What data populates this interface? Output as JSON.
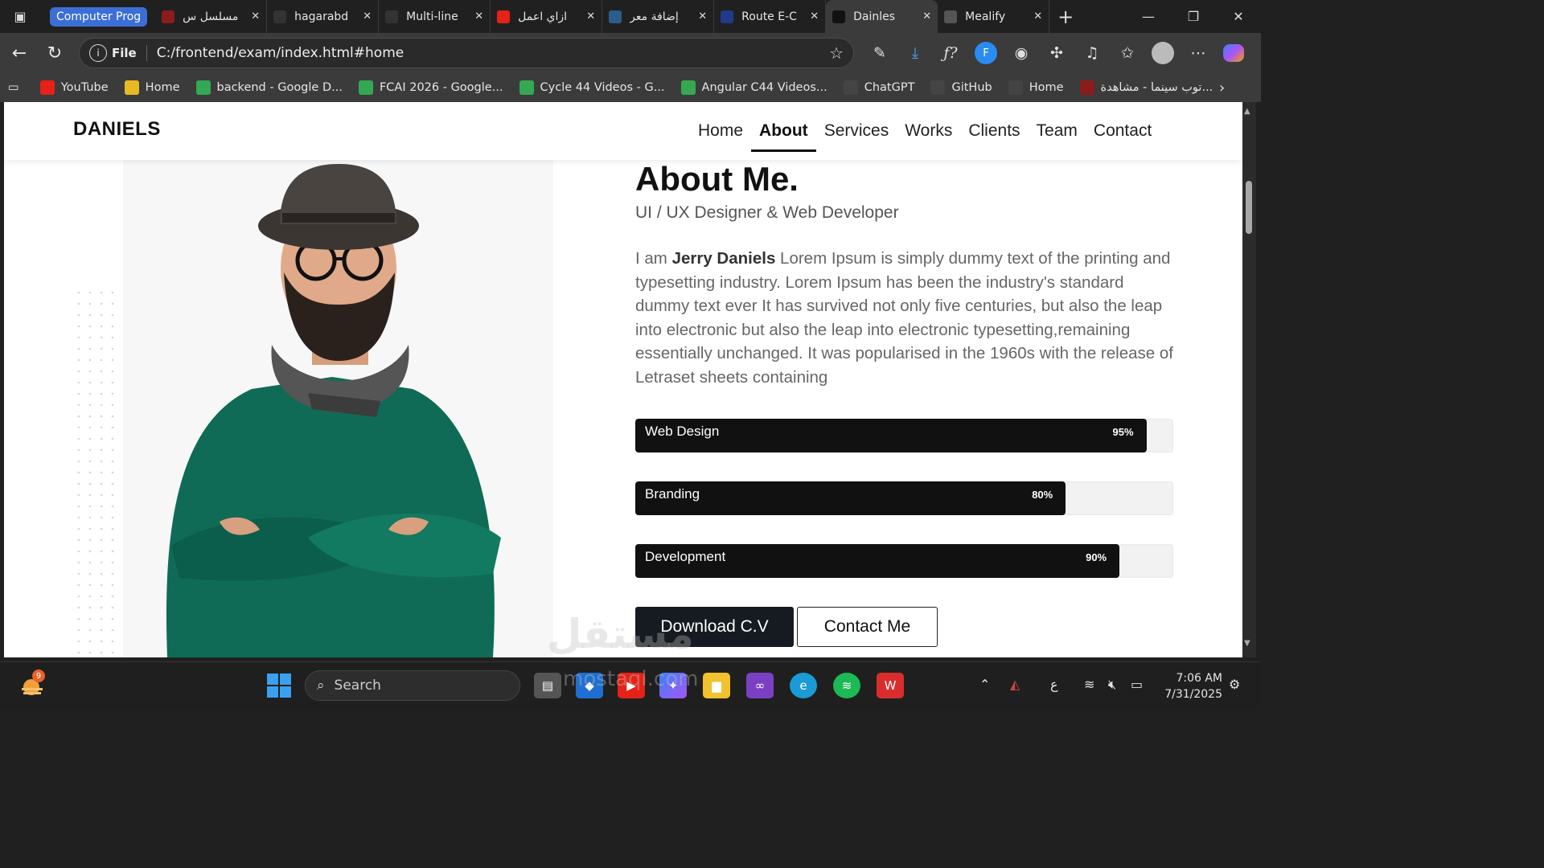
{
  "browser": {
    "tab_group": "Computer Prog",
    "tabs": [
      {
        "label": "مسلسل س",
        "icon": "top-cinema-icon",
        "color": "#8b1c1c"
      },
      {
        "label": "hagarabd",
        "icon": "github-icon",
        "color": "#333333"
      },
      {
        "label": "Multi-line",
        "icon": "chatgpt-icon",
        "color": "#333333"
      },
      {
        "label": "ازاي اعمل",
        "icon": "youtube-icon",
        "color": "#e62117"
      },
      {
        "label": "إضافة معر",
        "icon": "circle-icon",
        "color": "#2b5d8c"
      },
      {
        "label": "Route E-C",
        "icon": "route-icon",
        "color": "#1f3a8a"
      },
      {
        "label": "Dainles",
        "icon": "h-icon",
        "color": "#111111",
        "active": true
      },
      {
        "label": "Mealify",
        "icon": "globe-icon",
        "color": "#555555"
      }
    ],
    "address": {
      "scheme_label": "File",
      "url": "C:/frontend/exam/index.html#home"
    },
    "bookmarks": [
      {
        "label": "YouTube",
        "color": "#e62117"
      },
      {
        "label": "Home",
        "color": "#e8b923"
      },
      {
        "label": "backend - Google D...",
        "color": "#34a853"
      },
      {
        "label": "FCAI 2026 - Google...",
        "color": "#34a853"
      },
      {
        "label": "Cycle 44 Videos - G...",
        "color": "#34a853"
      },
      {
        "label": "Angular C44 Videos...",
        "color": "#34a853"
      },
      {
        "label": "ChatGPT",
        "color": "#444444"
      },
      {
        "label": "GitHub",
        "color": "#444444"
      },
      {
        "label": "Home",
        "color": "#444444"
      },
      {
        "label": "توب سينما - مشاهدة...",
        "color": "#8b1c1c"
      }
    ]
  },
  "site": {
    "brand": "DANIELS",
    "nav": [
      "Home",
      "About",
      "Services",
      "Works",
      "Clients",
      "Team",
      "Contact"
    ],
    "active_nav": "About",
    "about": {
      "title": "About Me.",
      "subtitle": "UI / UX Designer & Web Developer",
      "intro": "I am ",
      "name": "Jerry Daniels",
      "body": " Lorem Ipsum is simply dummy text of the printing and typesetting industry. Lorem Ipsum has been the industry's standard dummy text ever It has survived not only five centuries, but also the leap into electronic but also the leap into electronic typesetting,remaining essentially unchanged. It was popularised in the 1960s with the release of Letraset sheets containing"
    },
    "skills": [
      {
        "name": "Web Design",
        "percent": 95,
        "label": "95%"
      },
      {
        "name": "Branding",
        "percent": 80,
        "label": "80%"
      },
      {
        "name": "Development",
        "percent": 90,
        "label": "90%"
      }
    ],
    "buttons": {
      "download": "Download C.V",
      "contact": "Contact Me"
    }
  },
  "taskbar": {
    "weather_badge": "9",
    "search_placeholder": "Search",
    "lang": "ع",
    "time": "7:06 AM",
    "date": "7/31/2025"
  },
  "watermark": {
    "text": "مستقل",
    "sub": "mostaql.com"
  }
}
